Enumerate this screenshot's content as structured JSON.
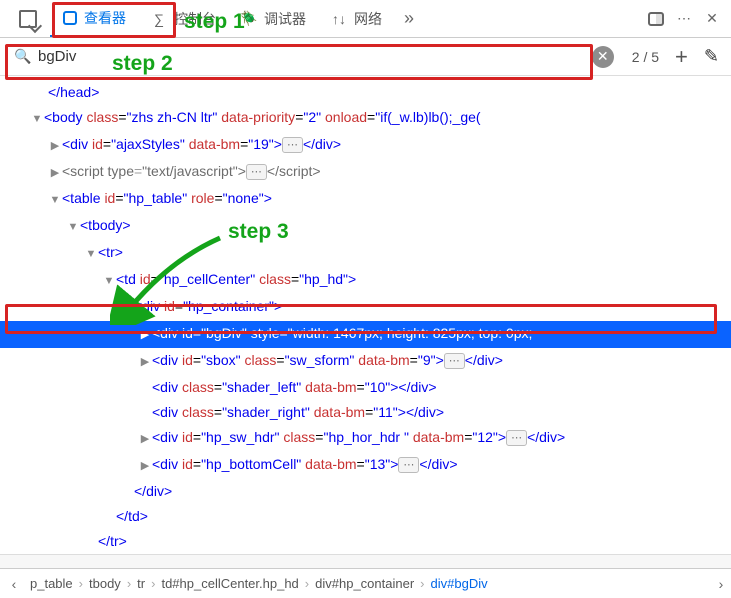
{
  "tabs": {
    "inspector": "查看器",
    "console": "控制台",
    "debugger": "调试器",
    "network": "网络",
    "more": "»",
    "dots": "⋯"
  },
  "search": {
    "value": "bgDiv",
    "count": "2 / 5"
  },
  "steps": {
    "s1": "step 1",
    "s2": "step 2",
    "s3": "step 3"
  },
  "tree": {
    "headClose": "</head>",
    "body_open_1": "<body ",
    "body_class_a": "class",
    "body_class_v": "\"zhs zh-CN ltr\"",
    "body_dp_a": "data-priority",
    "body_dp_v": "\"2\"",
    "body_onload_a": "onload",
    "body_onload_v": "\"if(_w.lb)lb();_ge(",
    "div_ajax_open": "<div ",
    "id_a": "id",
    "ajax_id_v": "\"ajaxStyles\"",
    "databm_a": "data-bm",
    "ajax_bm_v": "\"19\"",
    "div_close": "</div>",
    "script_open": "<script ",
    "type_a": "type",
    "script_type_v": "\"text/javascript\"",
    "script_close_txt": "</script>",
    "table_open": "<table ",
    "table_id_v": "\"hp_table\"",
    "role_a": "role",
    "table_role_v": "\"none\"",
    "tbody_open": "<tbody>",
    "tr_open": "<tr>",
    "td_open": "<td ",
    "td_id_v": "\"hp_cellCenter\"",
    "class_a": "class",
    "td_class_v": "\"hp_hd\"",
    "hpcont_open": "<div ",
    "hpcont_id_v": "\"hp_container\"",
    "bgdiv_open": "<div ",
    "bgdiv_id_v": "\"bgDiv\"",
    "style_a": "style",
    "bgdiv_style_v": "\"width: 1467px; height: 825px; top: 0px;",
    "sbox_open": "<div ",
    "sbox_id_v": "\"sbox\"",
    "sbox_class_v": "\"sw_sform\"",
    "sbox_bm_v": "\"9\"",
    "shl_class_v": "\"shader_left\"",
    "shl_bm_v": "\"10\"",
    "shr_class_v": "\"shader_right\"",
    "shr_bm_v": "\"11\"",
    "swh_id_v": "\"hp_sw_hdr\"",
    "swh_class_v": "\"hp_hor_hdr \"",
    "swh_bm_v": "\"12\"",
    "bot_id_v": "\"hp_bottomCell\"",
    "bot_bm_v": "\"13\"",
    "div_end": "</div>",
    "td_end": "</td>",
    "tr_end": "</tr>",
    "gt": ">"
  },
  "crumbs": {
    "c1": "p_table",
    "c2": "tbody",
    "c3": "tr",
    "c4": "td#hp_cellCenter.hp_hd",
    "c5": "div#hp_container",
    "c6": "div#bgDiv"
  },
  "glyph": {
    "console": "∑",
    "bug": "🐞",
    "net": "↑↓",
    "dock": "⧉",
    "mag": "🔍"
  }
}
